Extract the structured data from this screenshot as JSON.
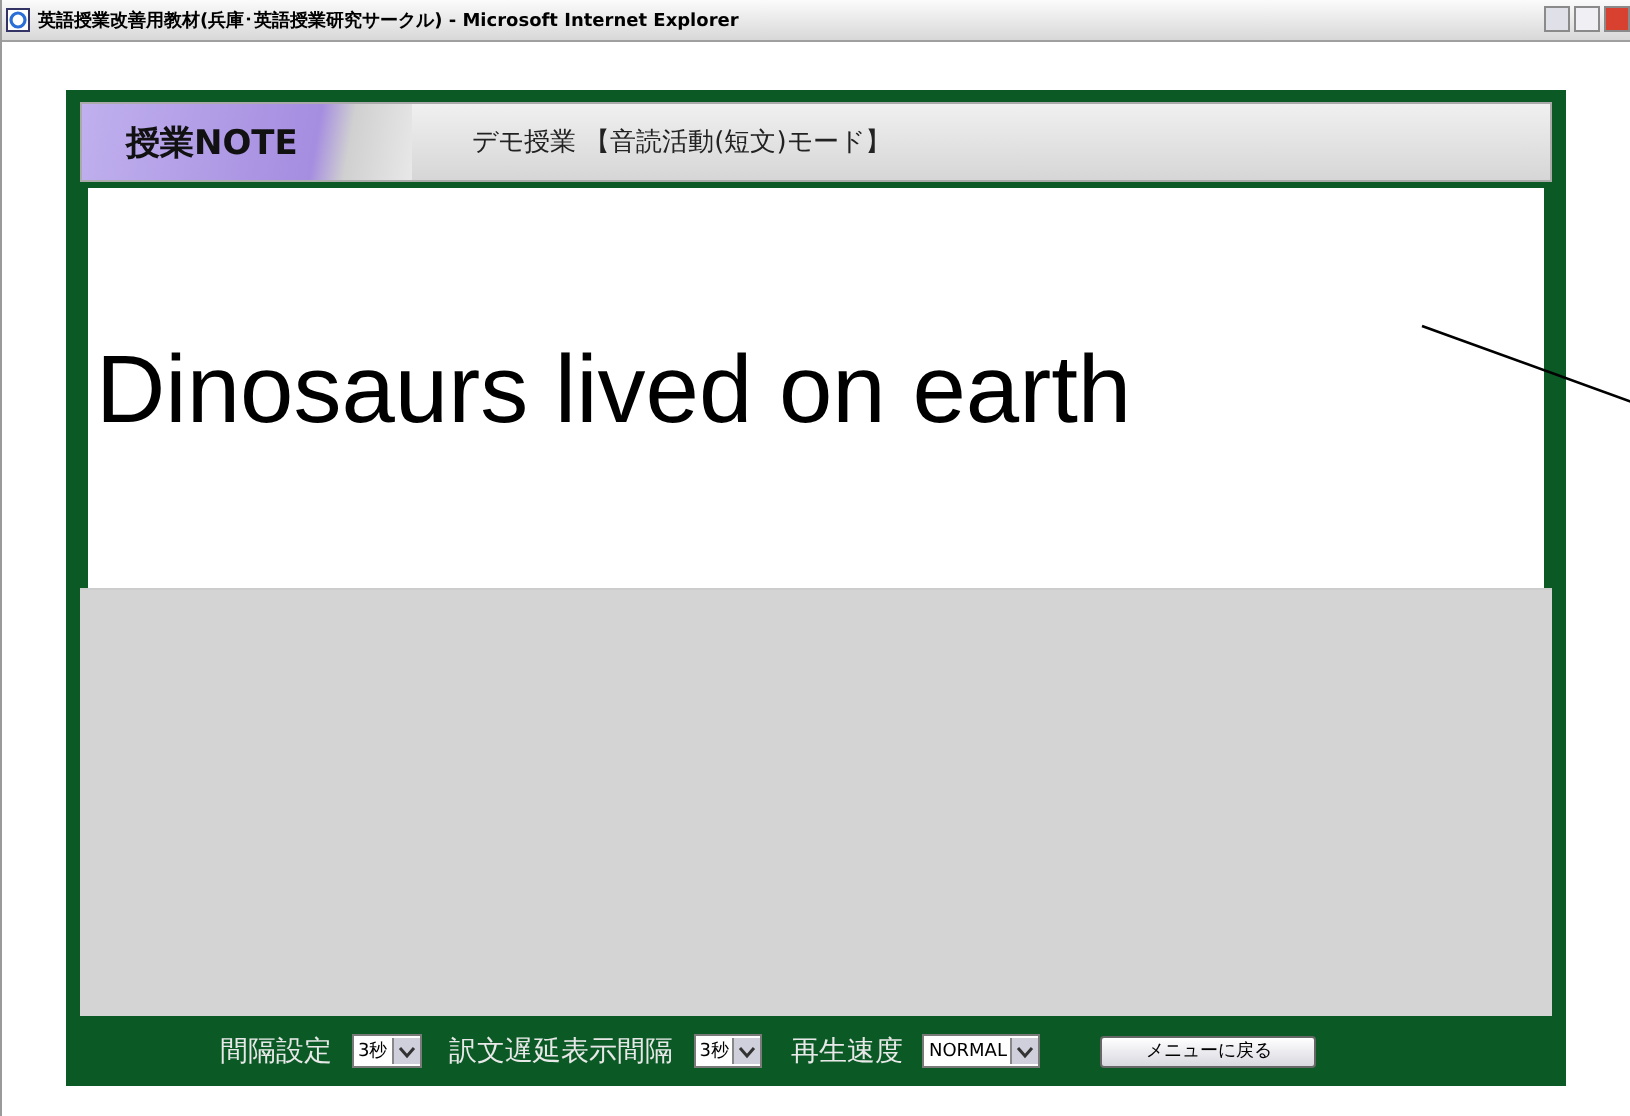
{
  "window": {
    "title": "英語授業改善用教材(兵庫･英語授業研究サークル) - Microsoft Internet Explorer"
  },
  "header": {
    "logo": "授業NOTE",
    "subtitle": "デモ授業 【音読活動(短文)モード】"
  },
  "content": {
    "sentence": "Dinosaurs lived on earth"
  },
  "controls": [
    {
      "kind": "select",
      "label": "間隔設定",
      "value": "3秒"
    },
    {
      "kind": "select",
      "label": "訳文遅延表示間隔",
      "value": "3秒"
    },
    {
      "kind": "select",
      "label": "再生速度",
      "value": "NORMAL"
    },
    {
      "kind": "button",
      "label": "メニューに戻る"
    }
  ]
}
